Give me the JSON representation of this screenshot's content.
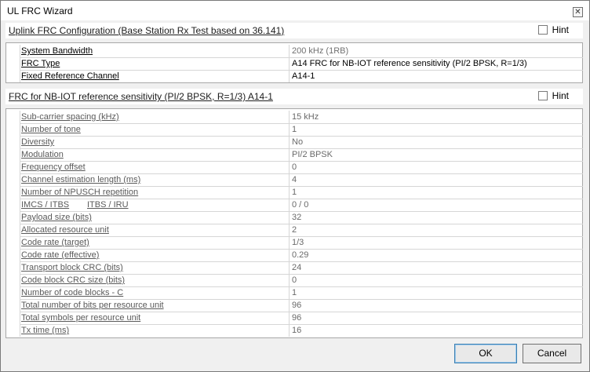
{
  "window": {
    "title": "UL FRC Wizard",
    "close_glyph": "✕"
  },
  "section1": {
    "title": "Uplink FRC Configuration (Base Station Rx Test based on 36.141)",
    "hint_label": "Hint",
    "rows": [
      {
        "label": "System Bandwidth",
        "value": "200 kHz (1RB)"
      },
      {
        "label": "FRC Type",
        "value": "A14 FRC for NB-IOT reference sensitivity (PI/2 BPSK, R=1/3)"
      },
      {
        "label": "Fixed Reference Channel",
        "value": "A14-1"
      }
    ]
  },
  "section2": {
    "title": "FRC for NB-IOT reference sensitivity (PI/2 BPSK, R=1/3) A14-1",
    "hint_label": "Hint",
    "rows": [
      {
        "label": "Sub-carrier spacing (kHz)",
        "value": "15 kHz"
      },
      {
        "label": "Number of tone",
        "value": "1"
      },
      {
        "label": "Diversity",
        "value": "No"
      },
      {
        "label": "Modulation",
        "value": "PI/2 BPSK"
      },
      {
        "label": "Frequency offset",
        "value": "0"
      },
      {
        "label": "Channel estimation length (ms)",
        "value": "4"
      },
      {
        "label": "Number of NPUSCH repetition",
        "value": "1"
      },
      {
        "label": "IMCS / ITBS",
        "label2": "ITBS / IRU",
        "value": "0 / 0"
      },
      {
        "label": "Payload size (bits)",
        "value": "32"
      },
      {
        "label": "Allocated resource unit",
        "value": "2"
      },
      {
        "label": "Code rate (target)",
        "value": "1/3"
      },
      {
        "label": "Code rate (effective)",
        "value": "0.29"
      },
      {
        "label": "Transport block CRC (bits)",
        "value": "24"
      },
      {
        "label": "Code block CRC size (bits)",
        "value": "0"
      },
      {
        "label": "Number of code blocks - C",
        "value": "1"
      },
      {
        "label": "Total number of bits per resource unit",
        "value": "96"
      },
      {
        "label": "Total symbols per resource unit",
        "value": "96"
      },
      {
        "label": "Tx time (ms)",
        "value": "16"
      }
    ]
  },
  "buttons": {
    "ok": "OK",
    "cancel": "Cancel"
  }
}
